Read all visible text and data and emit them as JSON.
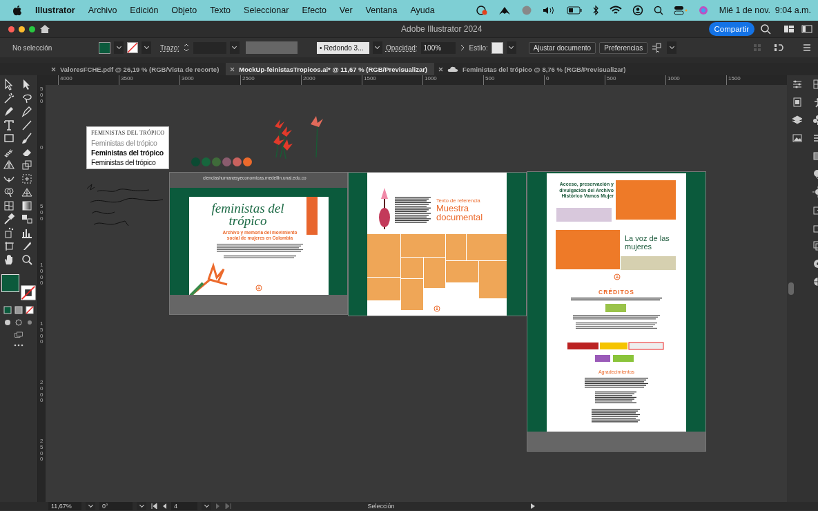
{
  "menubar": {
    "app": "Illustrator",
    "menus": [
      "Archivo",
      "Edición",
      "Objeto",
      "Texto",
      "Seleccionar",
      "Efecto",
      "Ver",
      "Ventana",
      "Ayuda"
    ],
    "clock": "Mié 1 de nov.  9:04 a.m."
  },
  "window": {
    "title": "Adobe Illustrator 2024",
    "share_button": "Compartir"
  },
  "control_bar": {
    "selection": "No selección",
    "stroke_label": "Trazo:",
    "brush": "•   Redondo 3...",
    "opacity_label": "Opacidad:",
    "opacity": "100%",
    "style_label": "Estilo:",
    "buttons": [
      "Ajustar documento",
      "Preferencias"
    ]
  },
  "tabs": [
    {
      "label": "ValoresFCHE.pdf @ 26,19 % (RGB/Vista de recorte)",
      "selected": false,
      "cloud": false
    },
    {
      "label": "MockUp-feinistasTropicos.ai* @ 11,67 % (RGB/Previsualizar)",
      "selected": true,
      "cloud": false
    },
    {
      "label": "Feministas del trópico @ 8,76 % (RGB/Previsualizar)",
      "selected": false,
      "cloud": true
    }
  ],
  "rulers": {
    "horizontal": [
      "4000",
      "3500",
      "3000",
      "2500",
      "2000",
      "1500",
      "1000",
      "500",
      "0",
      "500",
      "1000",
      "1500"
    ],
    "vertical": [
      "500",
      "0",
      "500",
      "1000",
      "1500",
      "2000",
      "2500"
    ]
  },
  "canvas": {
    "type_specimen": [
      "FEMINISTAS DEL TRÓPICO",
      "Feministas del trópico",
      "Feministas del trópico",
      "Feministas del trópico"
    ],
    "swatches": [
      {
        "color": "#0b4a32"
      },
      {
        "color": "#17663d"
      },
      {
        "color": "#3f6b3a"
      },
      {
        "color": "#8a5c6e"
      },
      {
        "color": "#c9625e"
      },
      {
        "color": "#ec6a2c"
      }
    ],
    "artboard_web": {
      "url": "cienciashumanasyeconomicas.medellin.unal.edu.co",
      "logo": "feministas del trópico",
      "subtitle": "Archivo y memoria del movimiento social de mujeres en Colombia"
    },
    "artboard_sample": {
      "kicker": "Texto de referencia",
      "heading": [
        "Muestra",
        "documental"
      ]
    },
    "artboard_archive": {
      "block_title": "Acceso, preservación y divulgación del Archivo Histórico Vamos Mujer",
      "voices_title": "La voz de las mujeres",
      "credits_title": "CRÉDITOS",
      "thanks_title": "Agradecimientos"
    }
  },
  "status_bar": {
    "zoom": "11,67%",
    "rotation": "0°",
    "artboard": "4",
    "tool": "Selección"
  }
}
